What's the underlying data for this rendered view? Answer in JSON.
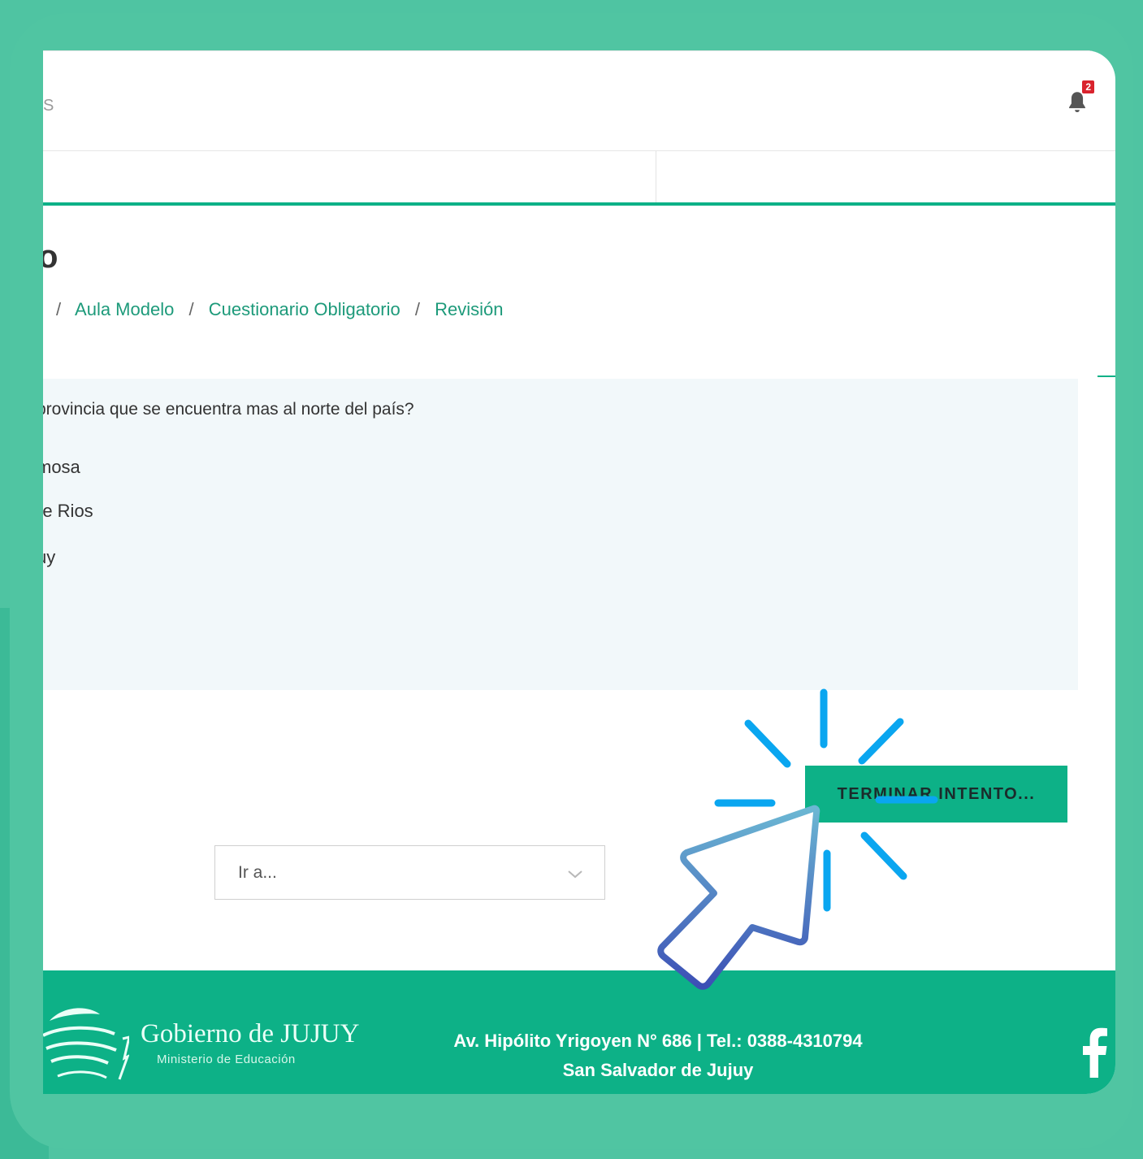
{
  "header": {
    "brand_fragment": "S",
    "notification_count": "2"
  },
  "page": {
    "heading_fragment": "o",
    "breadcrumb": [
      {
        "label": "Aula Modelo"
      },
      {
        "label": "Cuestionario Obligatorio"
      },
      {
        "label": "Revisión"
      }
    ]
  },
  "question": {
    "text": "provincia que se encuentra mas al norte del país?",
    "options": [
      "mosa",
      "re Rios",
      "uy"
    ]
  },
  "actions": {
    "finish_label": "TERMINAR INTENTO..."
  },
  "navigation": {
    "goto_label": "Ir a..."
  },
  "footer": {
    "gov_name": "Gobierno de JUJUY",
    "ministry": "Ministerio de Educación",
    "address_line1": "Av. Hipólito Yrigoyen N° 686 | Tel.: 0388-4310794",
    "address_line2": "San Salvador de Jujuy"
  },
  "colors": {
    "frame": "#4fc4a2",
    "accent": "#0db187",
    "link": "#1d9a7a",
    "cursor_top": "#6bb7d3",
    "cursor_bottom": "#3c4fb5",
    "sparkle": "#0aa6f0"
  },
  "icons": [
    "bell-icon",
    "chevron-down-icon",
    "facebook-icon",
    "gobierno-logo",
    "cursor-pointer-icon",
    "click-sparkle"
  ]
}
